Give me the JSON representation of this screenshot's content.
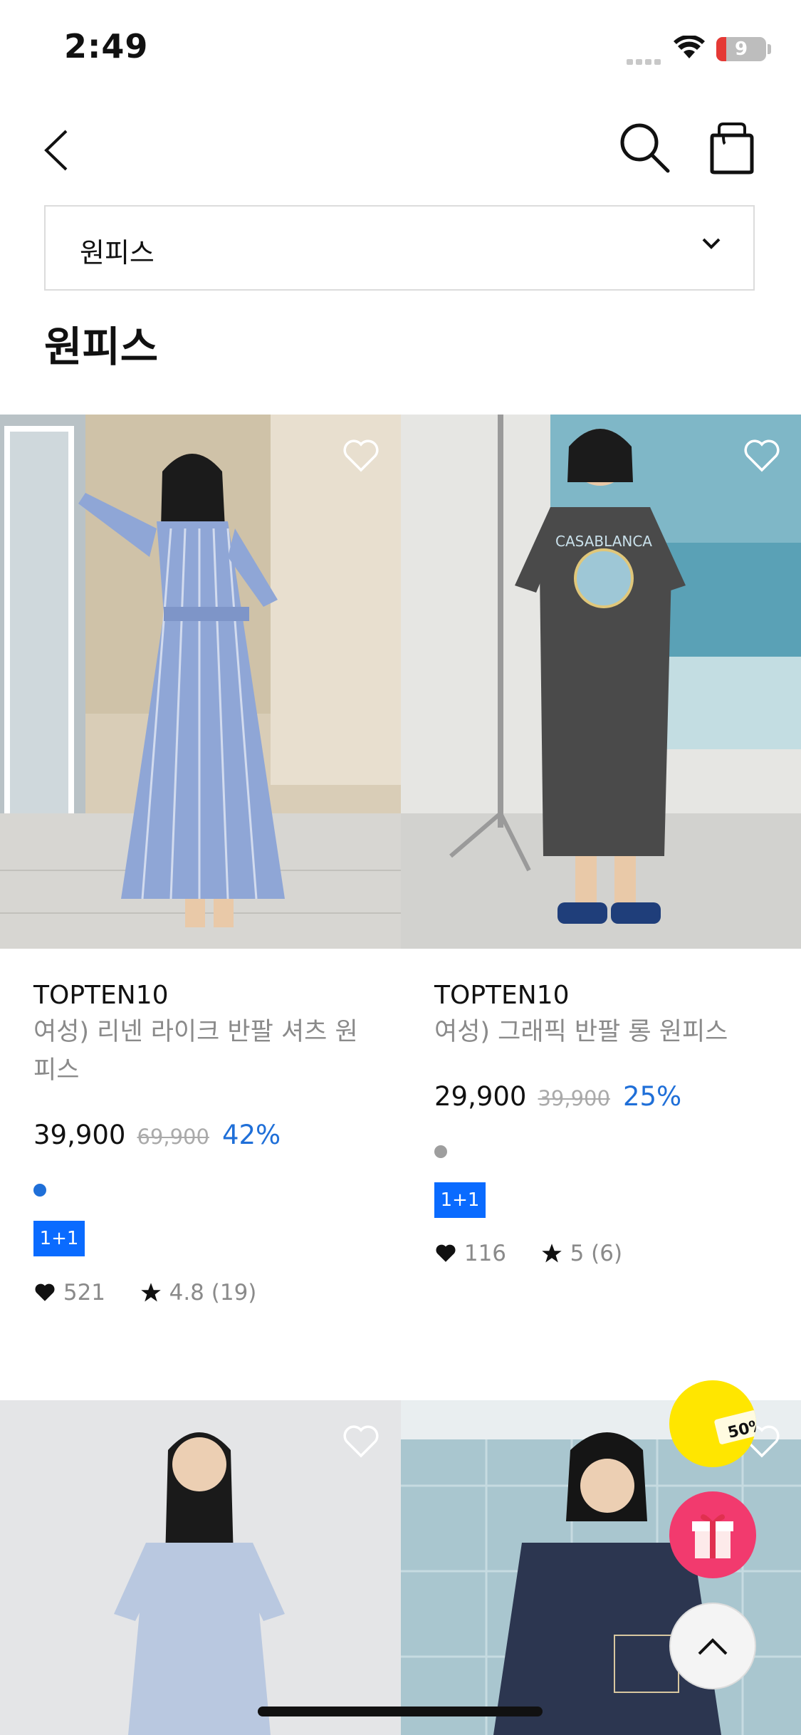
{
  "status_bar": {
    "time": "2:49",
    "battery": "9"
  },
  "nav": {
    "back_icon": "chevron-left-icon",
    "search_icon": "search-icon",
    "bag_icon": "shopping-bag-icon"
  },
  "category_select": {
    "value": "원피스"
  },
  "page_title": "원피스",
  "products": [
    {
      "brand": "TOPTEN10",
      "name": "여성) 리넨 라이크 반팔 셔츠 원피스",
      "price": "39,900",
      "original_price": "69,900",
      "discount": "42%",
      "color_dot": "#1f6fd8",
      "badge": "1+1",
      "likes": "521",
      "rating": "4.8 (19)"
    },
    {
      "brand": "TOPTEN10",
      "name": "여성) 그래픽 반팔 롱 원피스",
      "price": "29,900",
      "original_price": "39,900",
      "discount": "25%",
      "color_dot": "#9e9e9e",
      "badge": "1+1",
      "likes": "116",
      "rating": "5 (6)"
    }
  ],
  "floating": {
    "promo_text": "50%"
  },
  "colors": {
    "accent": "#1f6fd8",
    "badge": "#0a6bff",
    "promo_yellow": "#ffe600",
    "gift_pink": "#f23a6e"
  }
}
